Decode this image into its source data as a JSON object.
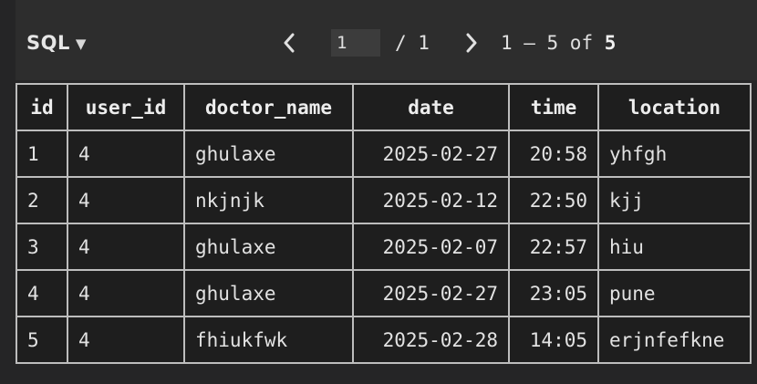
{
  "toolbar": {
    "sql_label": "SQL",
    "page_value": "1",
    "page_total": "/ 1",
    "range_text": "1 – 5 of ",
    "range_total": "5"
  },
  "table": {
    "columns": [
      "id",
      "user_id",
      "doctor_name",
      "date",
      "time",
      "location"
    ],
    "rows": [
      [
        "1",
        "4",
        "ghulaxe",
        "2025-02-27",
        "20:58",
        "yhfgh"
      ],
      [
        "2",
        "4",
        "nkjnjk",
        "2025-02-12",
        "22:50",
        "kjj"
      ],
      [
        "3",
        "4",
        "ghulaxe",
        "2025-02-07",
        "22:57",
        "hiu"
      ],
      [
        "4",
        "4",
        "ghulaxe",
        "2025-02-27",
        "23:05",
        "pune"
      ],
      [
        "5",
        "4",
        "fhiukfwk",
        "2025-02-28",
        "14:05",
        "erjnfefkne"
      ]
    ]
  }
}
